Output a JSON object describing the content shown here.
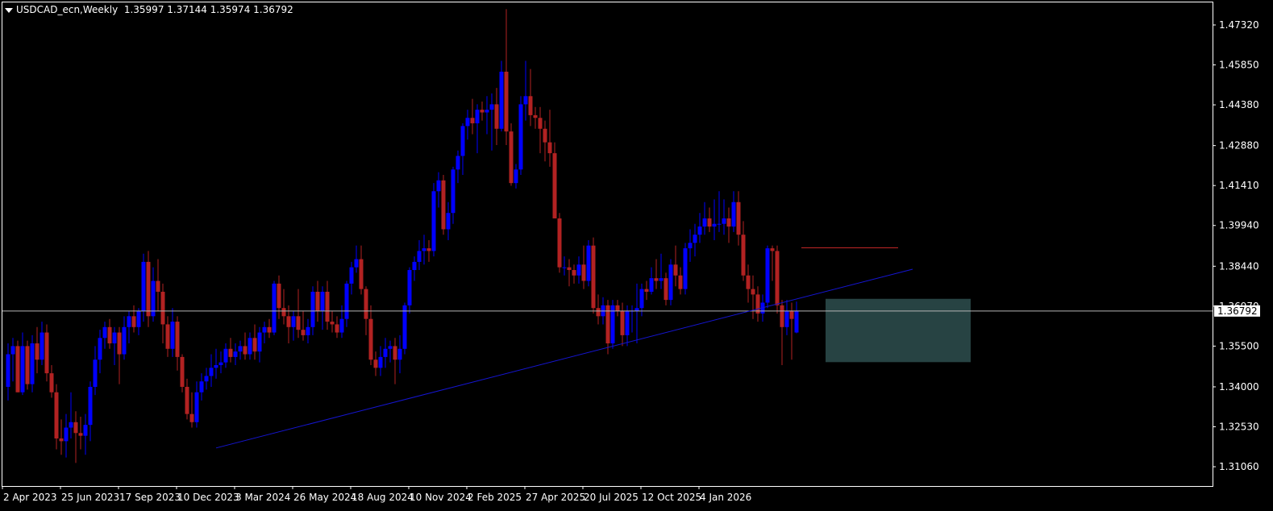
{
  "header": {
    "symbol": "USDCAD_ecn,Weekly",
    "ohlc": "1.35997 1.37144 1.35974 1.36792"
  },
  "colors": {
    "background": "#000000",
    "bull": "#0000FF",
    "bear": "#B22222",
    "trendline": "#1515D0",
    "hline": "#B4B4B4",
    "resistance": "#CC2A2A",
    "zone": "#2E4F4F",
    "axis": "#FFFFFF"
  },
  "chart_data": {
    "type": "candlestick",
    "timeframe": "Weekly",
    "ylim": [
      1.3035,
      1.4815
    ],
    "y_ticks": [
      "1.47320",
      "1.45850",
      "1.44380",
      "1.42880",
      "1.41410",
      "1.39940",
      "1.38440",
      "1.36970",
      "1.35500",
      "1.34000",
      "1.32530",
      "1.31060"
    ],
    "x_labels": [
      "2 Apr 2023",
      "25 Jun 2023",
      "17 Sep 2023",
      "10 Dec 2023",
      "3 Mar 2024",
      "26 May 2024",
      "18 Aug 2024",
      "10 Nov 2024",
      "2 Feb 2025",
      "27 Apr 2025",
      "20 Jul 2025",
      "12 Oct 2025",
      "4 Jan 2026"
    ],
    "current_price": "1.36792",
    "candles": [
      {
        "o": 1.34,
        "h": 1.356,
        "l": 1.335,
        "c": 1.352
      },
      {
        "o": 1.352,
        "h": 1.358,
        "l": 1.342,
        "c": 1.355
      },
      {
        "o": 1.355,
        "h": 1.357,
        "l": 1.338,
        "c": 1.338
      },
      {
        "o": 1.338,
        "h": 1.36,
        "l": 1.337,
        "c": 1.355
      },
      {
        "o": 1.355,
        "h": 1.357,
        "l": 1.339,
        "c": 1.341
      },
      {
        "o": 1.341,
        "h": 1.359,
        "l": 1.338,
        "c": 1.356
      },
      {
        "o": 1.356,
        "h": 1.362,
        "l": 1.345,
        "c": 1.35
      },
      {
        "o": 1.35,
        "h": 1.364,
        "l": 1.348,
        "c": 1.36
      },
      {
        "o": 1.36,
        "h": 1.363,
        "l": 1.342,
        "c": 1.345
      },
      {
        "o": 1.345,
        "h": 1.348,
        "l": 1.336,
        "c": 1.338
      },
      {
        "o": 1.338,
        "h": 1.341,
        "l": 1.317,
        "c": 1.321
      },
      {
        "o": 1.321,
        "h": 1.328,
        "l": 1.315,
        "c": 1.32
      },
      {
        "o": 1.32,
        "h": 1.33,
        "l": 1.314,
        "c": 1.325
      },
      {
        "o": 1.325,
        "h": 1.338,
        "l": 1.321,
        "c": 1.327
      },
      {
        "o": 1.327,
        "h": 1.331,
        "l": 1.312,
        "c": 1.323
      },
      {
        "o": 1.323,
        "h": 1.329,
        "l": 1.317,
        "c": 1.322
      },
      {
        "o": 1.322,
        "h": 1.33,
        "l": 1.315,
        "c": 1.326
      },
      {
        "o": 1.326,
        "h": 1.342,
        "l": 1.32,
        "c": 1.34
      },
      {
        "o": 1.34,
        "h": 1.355,
        "l": 1.337,
        "c": 1.35
      },
      {
        "o": 1.35,
        "h": 1.361,
        "l": 1.345,
        "c": 1.358
      },
      {
        "o": 1.358,
        "h": 1.364,
        "l": 1.354,
        "c": 1.362
      },
      {
        "o": 1.362,
        "h": 1.365,
        "l": 1.354,
        "c": 1.356
      },
      {
        "o": 1.356,
        "h": 1.362,
        "l": 1.348,
        "c": 1.36
      },
      {
        "o": 1.36,
        "h": 1.362,
        "l": 1.341,
        "c": 1.352
      },
      {
        "o": 1.352,
        "h": 1.366,
        "l": 1.35,
        "c": 1.362
      },
      {
        "o": 1.362,
        "h": 1.368,
        "l": 1.356,
        "c": 1.366
      },
      {
        "o": 1.366,
        "h": 1.37,
        "l": 1.36,
        "c": 1.362
      },
      {
        "o": 1.362,
        "h": 1.369,
        "l": 1.359,
        "c": 1.368
      },
      {
        "o": 1.368,
        "h": 1.389,
        "l": 1.364,
        "c": 1.386
      },
      {
        "o": 1.386,
        "h": 1.39,
        "l": 1.362,
        "c": 1.366
      },
      {
        "o": 1.366,
        "h": 1.384,
        "l": 1.364,
        "c": 1.379
      },
      {
        "o": 1.379,
        "h": 1.387,
        "l": 1.368,
        "c": 1.375
      },
      {
        "o": 1.375,
        "h": 1.378,
        "l": 1.356,
        "c": 1.363
      },
      {
        "o": 1.363,
        "h": 1.366,
        "l": 1.351,
        "c": 1.354
      },
      {
        "o": 1.354,
        "h": 1.369,
        "l": 1.351,
        "c": 1.364
      },
      {
        "o": 1.364,
        "h": 1.366,
        "l": 1.346,
        "c": 1.351
      },
      {
        "o": 1.351,
        "h": 1.352,
        "l": 1.338,
        "c": 1.34
      },
      {
        "o": 1.34,
        "h": 1.343,
        "l": 1.328,
        "c": 1.33
      },
      {
        "o": 1.33,
        "h": 1.338,
        "l": 1.325,
        "c": 1.327
      },
      {
        "o": 1.327,
        "h": 1.342,
        "l": 1.325,
        "c": 1.338
      },
      {
        "o": 1.338,
        "h": 1.345,
        "l": 1.335,
        "c": 1.342
      },
      {
        "o": 1.342,
        "h": 1.347,
        "l": 1.339,
        "c": 1.344
      },
      {
        "o": 1.344,
        "h": 1.352,
        "l": 1.34,
        "c": 1.347
      },
      {
        "o": 1.347,
        "h": 1.354,
        "l": 1.343,
        "c": 1.348
      },
      {
        "o": 1.348,
        "h": 1.353,
        "l": 1.345,
        "c": 1.349
      },
      {
        "o": 1.349,
        "h": 1.356,
        "l": 1.347,
        "c": 1.354
      },
      {
        "o": 1.354,
        "h": 1.358,
        "l": 1.349,
        "c": 1.351
      },
      {
        "o": 1.351,
        "h": 1.356,
        "l": 1.348,
        "c": 1.353
      },
      {
        "o": 1.353,
        "h": 1.357,
        "l": 1.35,
        "c": 1.355
      },
      {
        "o": 1.355,
        "h": 1.36,
        "l": 1.35,
        "c": 1.352
      },
      {
        "o": 1.352,
        "h": 1.36,
        "l": 1.35,
        "c": 1.358
      },
      {
        "o": 1.358,
        "h": 1.363,
        "l": 1.35,
        "c": 1.353
      },
      {
        "o": 1.353,
        "h": 1.362,
        "l": 1.349,
        "c": 1.36
      },
      {
        "o": 1.36,
        "h": 1.364,
        "l": 1.356,
        "c": 1.362
      },
      {
        "o": 1.362,
        "h": 1.365,
        "l": 1.358,
        "c": 1.36
      },
      {
        "o": 1.36,
        "h": 1.379,
        "l": 1.359,
        "c": 1.378
      },
      {
        "o": 1.378,
        "h": 1.381,
        "l": 1.365,
        "c": 1.369
      },
      {
        "o": 1.369,
        "h": 1.376,
        "l": 1.363,
        "c": 1.366
      },
      {
        "o": 1.366,
        "h": 1.37,
        "l": 1.356,
        "c": 1.362
      },
      {
        "o": 1.362,
        "h": 1.368,
        "l": 1.357,
        "c": 1.366
      },
      {
        "o": 1.366,
        "h": 1.376,
        "l": 1.358,
        "c": 1.361
      },
      {
        "o": 1.361,
        "h": 1.368,
        "l": 1.357,
        "c": 1.359
      },
      {
        "o": 1.359,
        "h": 1.365,
        "l": 1.356,
        "c": 1.362
      },
      {
        "o": 1.362,
        "h": 1.377,
        "l": 1.359,
        "c": 1.375
      },
      {
        "o": 1.375,
        "h": 1.379,
        "l": 1.364,
        "c": 1.368
      },
      {
        "o": 1.368,
        "h": 1.377,
        "l": 1.361,
        "c": 1.375
      },
      {
        "o": 1.375,
        "h": 1.379,
        "l": 1.361,
        "c": 1.364
      },
      {
        "o": 1.364,
        "h": 1.368,
        "l": 1.36,
        "c": 1.363
      },
      {
        "o": 1.363,
        "h": 1.366,
        "l": 1.358,
        "c": 1.36
      },
      {
        "o": 1.36,
        "h": 1.37,
        "l": 1.358,
        "c": 1.365
      },
      {
        "o": 1.365,
        "h": 1.379,
        "l": 1.362,
        "c": 1.378
      },
      {
        "o": 1.378,
        "h": 1.386,
        "l": 1.374,
        "c": 1.384
      },
      {
        "o": 1.384,
        "h": 1.392,
        "l": 1.382,
        "c": 1.387
      },
      {
        "o": 1.387,
        "h": 1.392,
        "l": 1.374,
        "c": 1.376
      },
      {
        "o": 1.376,
        "h": 1.377,
        "l": 1.359,
        "c": 1.365
      },
      {
        "o": 1.365,
        "h": 1.37,
        "l": 1.348,
        "c": 1.35
      },
      {
        "o": 1.35,
        "h": 1.353,
        "l": 1.344,
        "c": 1.347
      },
      {
        "o": 1.347,
        "h": 1.355,
        "l": 1.344,
        "c": 1.351
      },
      {
        "o": 1.351,
        "h": 1.358,
        "l": 1.347,
        "c": 1.354
      },
      {
        "o": 1.354,
        "h": 1.357,
        "l": 1.349,
        "c": 1.355
      },
      {
        "o": 1.355,
        "h": 1.358,
        "l": 1.341,
        "c": 1.35
      },
      {
        "o": 1.35,
        "h": 1.359,
        "l": 1.345,
        "c": 1.354
      },
      {
        "o": 1.354,
        "h": 1.371,
        "l": 1.352,
        "c": 1.37
      },
      {
        "o": 1.37,
        "h": 1.384,
        "l": 1.367,
        "c": 1.383
      },
      {
        "o": 1.383,
        "h": 1.388,
        "l": 1.379,
        "c": 1.386
      },
      {
        "o": 1.386,
        "h": 1.394,
        "l": 1.383,
        "c": 1.39
      },
      {
        "o": 1.39,
        "h": 1.396,
        "l": 1.385,
        "c": 1.391
      },
      {
        "o": 1.391,
        "h": 1.394,
        "l": 1.386,
        "c": 1.39
      },
      {
        "o": 1.39,
        "h": 1.415,
        "l": 1.388,
        "c": 1.412
      },
      {
        "o": 1.412,
        "h": 1.419,
        "l": 1.406,
        "c": 1.416
      },
      {
        "o": 1.416,
        "h": 1.418,
        "l": 1.396,
        "c": 1.398
      },
      {
        "o": 1.398,
        "h": 1.408,
        "l": 1.394,
        "c": 1.404
      },
      {
        "o": 1.404,
        "h": 1.421,
        "l": 1.4,
        "c": 1.42
      },
      {
        "o": 1.42,
        "h": 1.427,
        "l": 1.415,
        "c": 1.425
      },
      {
        "o": 1.425,
        "h": 1.437,
        "l": 1.418,
        "c": 1.436
      },
      {
        "o": 1.436,
        "h": 1.442,
        "l": 1.431,
        "c": 1.439
      },
      {
        "o": 1.439,
        "h": 1.446,
        "l": 1.433,
        "c": 1.437
      },
      {
        "o": 1.437,
        "h": 1.444,
        "l": 1.426,
        "c": 1.442
      },
      {
        "o": 1.442,
        "h": 1.445,
        "l": 1.438,
        "c": 1.441
      },
      {
        "o": 1.441,
        "h": 1.447,
        "l": 1.433,
        "c": 1.442
      },
      {
        "o": 1.442,
        "h": 1.448,
        "l": 1.427,
        "c": 1.444
      },
      {
        "o": 1.444,
        "h": 1.45,
        "l": 1.429,
        "c": 1.435
      },
      {
        "o": 1.435,
        "h": 1.46,
        "l": 1.434,
        "c": 1.456
      },
      {
        "o": 1.456,
        "h": 1.479,
        "l": 1.429,
        "c": 1.434
      },
      {
        "o": 1.434,
        "h": 1.437,
        "l": 1.414,
        "c": 1.415
      },
      {
        "o": 1.415,
        "h": 1.422,
        "l": 1.413,
        "c": 1.42
      },
      {
        "o": 1.42,
        "h": 1.447,
        "l": 1.418,
        "c": 1.444
      },
      {
        "o": 1.444,
        "h": 1.46,
        "l": 1.438,
        "c": 1.447
      },
      {
        "o": 1.447,
        "h": 1.457,
        "l": 1.436,
        "c": 1.44
      },
      {
        "o": 1.44,
        "h": 1.443,
        "l": 1.435,
        "c": 1.439
      },
      {
        "o": 1.439,
        "h": 1.443,
        "l": 1.426,
        "c": 1.435
      },
      {
        "o": 1.435,
        "h": 1.438,
        "l": 1.423,
        "c": 1.43
      },
      {
        "o": 1.43,
        "h": 1.442,
        "l": 1.421,
        "c": 1.426
      },
      {
        "o": 1.426,
        "h": 1.43,
        "l": 1.402,
        "c": 1.402
      },
      {
        "o": 1.402,
        "h": 1.404,
        "l": 1.382,
        "c": 1.384
      },
      {
        "o": 1.384,
        "h": 1.388,
        "l": 1.381,
        "c": 1.384
      },
      {
        "o": 1.384,
        "h": 1.387,
        "l": 1.377,
        "c": 1.383
      },
      {
        "o": 1.383,
        "h": 1.385,
        "l": 1.378,
        "c": 1.381
      },
      {
        "o": 1.381,
        "h": 1.388,
        "l": 1.378,
        "c": 1.385
      },
      {
        "o": 1.385,
        "h": 1.392,
        "l": 1.376,
        "c": 1.379
      },
      {
        "o": 1.379,
        "h": 1.394,
        "l": 1.377,
        "c": 1.392
      },
      {
        "o": 1.392,
        "h": 1.395,
        "l": 1.367,
        "c": 1.369
      },
      {
        "o": 1.369,
        "h": 1.374,
        "l": 1.363,
        "c": 1.366
      },
      {
        "o": 1.366,
        "h": 1.373,
        "l": 1.363,
        "c": 1.37
      },
      {
        "o": 1.37,
        "h": 1.372,
        "l": 1.352,
        "c": 1.356
      },
      {
        "o": 1.356,
        "h": 1.372,
        "l": 1.354,
        "c": 1.37
      },
      {
        "o": 1.37,
        "h": 1.372,
        "l": 1.366,
        "c": 1.368
      },
      {
        "o": 1.368,
        "h": 1.371,
        "l": 1.355,
        "c": 1.359
      },
      {
        "o": 1.359,
        "h": 1.37,
        "l": 1.355,
        "c": 1.368
      },
      {
        "o": 1.368,
        "h": 1.37,
        "l": 1.36,
        "c": 1.368
      },
      {
        "o": 1.368,
        "h": 1.378,
        "l": 1.356,
        "c": 1.369
      },
      {
        "o": 1.369,
        "h": 1.378,
        "l": 1.366,
        "c": 1.376
      },
      {
        "o": 1.376,
        "h": 1.379,
        "l": 1.372,
        "c": 1.375
      },
      {
        "o": 1.375,
        "h": 1.384,
        "l": 1.374,
        "c": 1.38
      },
      {
        "o": 1.38,
        "h": 1.387,
        "l": 1.376,
        "c": 1.379
      },
      {
        "o": 1.379,
        "h": 1.389,
        "l": 1.376,
        "c": 1.38
      },
      {
        "o": 1.38,
        "h": 1.382,
        "l": 1.37,
        "c": 1.372
      },
      {
        "o": 1.372,
        "h": 1.387,
        "l": 1.37,
        "c": 1.385
      },
      {
        "o": 1.385,
        "h": 1.392,
        "l": 1.377,
        "c": 1.381
      },
      {
        "o": 1.381,
        "h": 1.384,
        "l": 1.374,
        "c": 1.376
      },
      {
        "o": 1.376,
        "h": 1.393,
        "l": 1.374,
        "c": 1.391
      },
      {
        "o": 1.391,
        "h": 1.398,
        "l": 1.386,
        "c": 1.393
      },
      {
        "o": 1.393,
        "h": 1.4,
        "l": 1.388,
        "c": 1.396
      },
      {
        "o": 1.396,
        "h": 1.404,
        "l": 1.393,
        "c": 1.399
      },
      {
        "o": 1.399,
        "h": 1.408,
        "l": 1.396,
        "c": 1.402
      },
      {
        "o": 1.402,
        "h": 1.406,
        "l": 1.397,
        "c": 1.399
      },
      {
        "o": 1.399,
        "h": 1.409,
        "l": 1.394,
        "c": 1.4
      },
      {
        "o": 1.4,
        "h": 1.412,
        "l": 1.397,
        "c": 1.4
      },
      {
        "o": 1.4,
        "h": 1.409,
        "l": 1.396,
        "c": 1.402
      },
      {
        "o": 1.402,
        "h": 1.406,
        "l": 1.393,
        "c": 1.399
      },
      {
        "o": 1.399,
        "h": 1.412,
        "l": 1.397,
        "c": 1.408
      },
      {
        "o": 1.408,
        "h": 1.412,
        "l": 1.392,
        "c": 1.396
      },
      {
        "o": 1.396,
        "h": 1.401,
        "l": 1.379,
        "c": 1.381
      },
      {
        "o": 1.381,
        "h": 1.385,
        "l": 1.371,
        "c": 1.376
      },
      {
        "o": 1.376,
        "h": 1.381,
        "l": 1.365,
        "c": 1.374
      },
      {
        "o": 1.374,
        "h": 1.377,
        "l": 1.364,
        "c": 1.367
      },
      {
        "o": 1.367,
        "h": 1.374,
        "l": 1.364,
        "c": 1.371
      },
      {
        "o": 1.371,
        "h": 1.392,
        "l": 1.369,
        "c": 1.391
      },
      {
        "o": 1.391,
        "h": 1.392,
        "l": 1.379,
        "c": 1.39
      },
      {
        "o": 1.39,
        "h": 1.392,
        "l": 1.367,
        "c": 1.37
      },
      {
        "o": 1.37,
        "h": 1.372,
        "l": 1.348,
        "c": 1.362
      },
      {
        "o": 1.362,
        "h": 1.372,
        "l": 1.359,
        "c": 1.368
      },
      {
        "o": 1.368,
        "h": 1.371,
        "l": 1.35,
        "c": 1.365
      },
      {
        "o": 1.36,
        "h": 1.3714,
        "l": 1.3597,
        "c": 1.3679
      }
    ],
    "annotations": {
      "trendline": {
        "from": {
          "bar": 43,
          "price": 1.3175
        },
        "to": {
          "bar": 187,
          "price": 1.3833
        }
      },
      "resistance_line": {
        "price": 1.3912,
        "from_bar": 164,
        "to_bar": 184
      },
      "zone": {
        "top": 1.3724,
        "bottom": 1.3491,
        "from_bar": 169,
        "to_bar": 199
      },
      "current_price_line": 1.36792
    }
  }
}
